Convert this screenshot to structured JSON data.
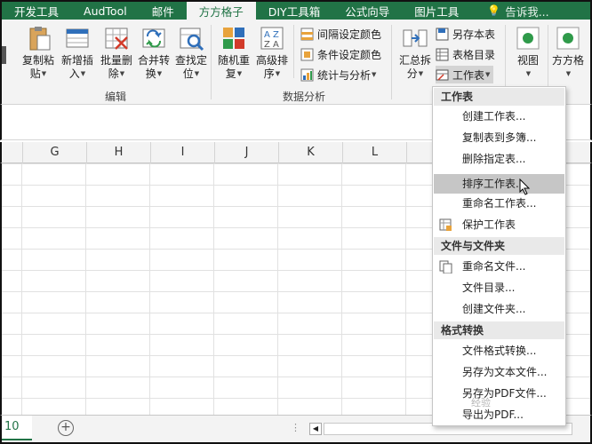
{
  "tabs": [
    {
      "label": "开发工具",
      "active": false
    },
    {
      "label": "AudTool",
      "active": false
    },
    {
      "label": "邮件",
      "active": false
    },
    {
      "label": "方方格子",
      "active": true
    },
    {
      "label": "DIY工具箱",
      "active": false
    },
    {
      "label": "公式向导",
      "active": false
    },
    {
      "label": "图片工具",
      "active": false
    }
  ],
  "tell_me": "告诉我...",
  "ribbon": {
    "edit_group": {
      "label": "编辑",
      "buttons": [
        {
          "line1": "复制粘",
          "line2": "贴"
        },
        {
          "line1": "新增插",
          "line2": "入"
        },
        {
          "line1": "批量删",
          "line2": "除"
        },
        {
          "line1": "合并转",
          "line2": "换"
        },
        {
          "line1": "查找定",
          "line2": "位"
        }
      ]
    },
    "analysis_group": {
      "label": "数据分析",
      "buttons": [
        {
          "line1": "随机重",
          "line2": "复"
        },
        {
          "line1": "高级排",
          "line2": "序"
        }
      ],
      "small": [
        {
          "label": "间隔设定颜色"
        },
        {
          "label": "条件设定颜色"
        },
        {
          "label": "统计与分析"
        }
      ]
    },
    "summary_group": {
      "big": {
        "line1": "汇总拆",
        "line2": "分"
      },
      "small": [
        {
          "label": "另存本表"
        },
        {
          "label": "表格目录"
        },
        {
          "label": "工作表"
        }
      ]
    },
    "view": {
      "label": "视图"
    },
    "fangfang": {
      "label": "方方格"
    }
  },
  "columns": [
    "G",
    "H",
    "I",
    "J",
    "K",
    "L"
  ],
  "sheet": {
    "tab_label": "10"
  },
  "menu": {
    "sections": [
      {
        "title": "工作表",
        "items": [
          "创建工作表...",
          "复制表到多簿...",
          "删除指定表...",
          "排序工作表...",
          "重命名工作表...",
          "保护工作表"
        ]
      },
      {
        "title": "文件与文件夹",
        "items": [
          "重命名文件...",
          "文件目录...",
          "创建文件夹..."
        ]
      },
      {
        "title": "格式转换",
        "items": [
          "文件格式转换...",
          "另存为文本文件...",
          "另存为PDF文件...",
          "导出为PDF..."
        ]
      }
    ],
    "hovered_item": "排序工作表..."
  },
  "watermark": "经验"
}
